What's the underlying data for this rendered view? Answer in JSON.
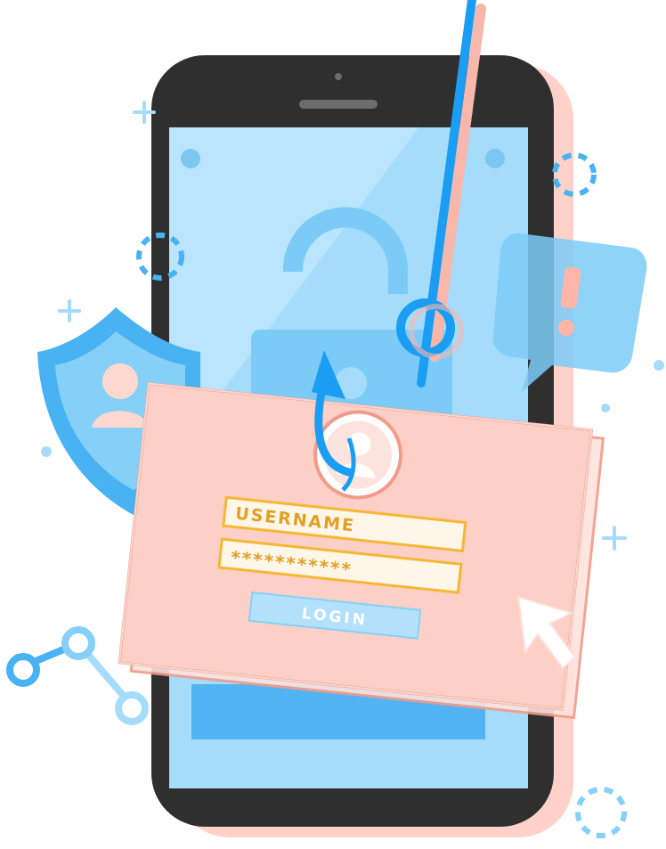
{
  "login_card": {
    "username_label": "USERNAME",
    "password_mask": "***********",
    "login_label": "LOGIN"
  },
  "colors": {
    "phone_body": "#2f2f2f",
    "phone_shadow": "#ffd2c9",
    "screen": "#a6dcfb",
    "accent_blue": "#1a9df2",
    "card_pink": "#fcd0c6",
    "card_border": "#f39b8a",
    "field_gold": "#f7b733",
    "field_fill": "#fff6ea",
    "login_button": "#b3e1fb"
  },
  "icons": {
    "phone": "smartphone-icon",
    "lock": "unlocked-padlock-icon",
    "hook": "fishing-hook-icon",
    "shield": "shield-user-icon",
    "alert": "alert-speech-bubble-icon",
    "share": "share-nodes-icon",
    "cursor": "mouse-pointer-icon",
    "avatar": "user-avatar-icon"
  }
}
